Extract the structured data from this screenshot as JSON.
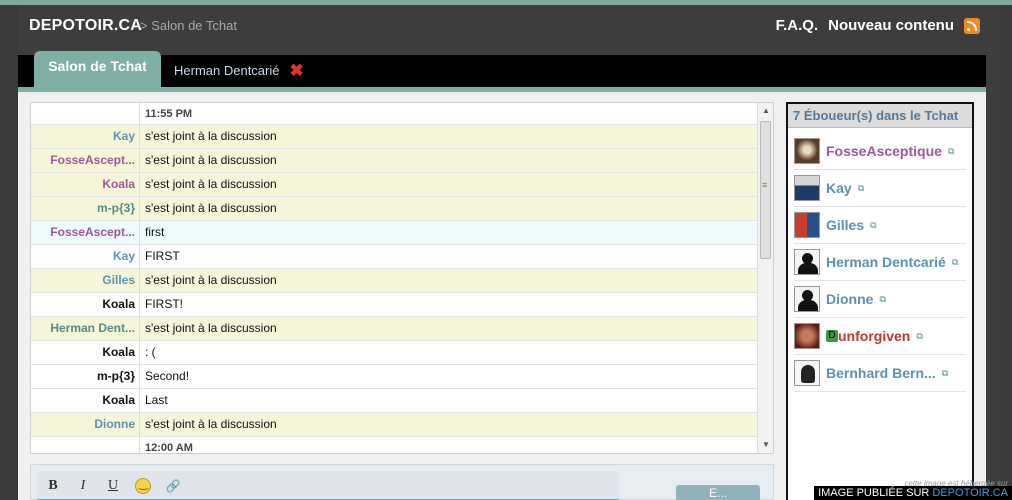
{
  "header": {
    "logo": "DEPOTOIR.CA",
    "breadcrumb": "> Salon de Tchat",
    "faq": "F.A.Q.",
    "new_content": "Nouveau contenu"
  },
  "tabs": {
    "active": "Salon de Tchat",
    "private_user": "Herman Dentcarié",
    "close_glyph": "✖"
  },
  "chat": {
    "time_top": "11:55 PM",
    "time_bottom": "12:00 AM",
    "messages": [
      {
        "who": "Kay",
        "msg": "s'est joint à la discussion",
        "type": "join",
        "color": "#5b93b5"
      },
      {
        "who": "FosseAscept...",
        "msg": "s'est joint à la discussion",
        "type": "join",
        "color": "#a0579d"
      },
      {
        "who": "Koala",
        "msg": "s'est joint à la discussion",
        "type": "join",
        "color": "#a0579d"
      },
      {
        "who": "m-p{3}",
        "msg": "s'est joint à la discussion",
        "type": "join",
        "color": "#4f8e8a"
      },
      {
        "who": "FosseAscept...",
        "msg": "first",
        "type": "hl",
        "color": "#a0579d"
      },
      {
        "who": "Kay",
        "msg": "FIRST",
        "type": "normal",
        "color": "#5b93b5"
      },
      {
        "who": "Gilles",
        "msg": "s'est joint à la discussion",
        "type": "join",
        "color": "#5b93b5"
      },
      {
        "who": "Koala",
        "msg": "FIRST!",
        "type": "normal",
        "color": "#111111"
      },
      {
        "who": "Herman Dent...",
        "msg": "s'est joint à la discussion",
        "type": "join",
        "color": "#4f8e8a"
      },
      {
        "who": "Koala",
        "msg": ": (",
        "type": "normal",
        "color": "#111111"
      },
      {
        "who": "m-p{3}",
        "msg": "Second!",
        "type": "normal",
        "color": "#111111"
      },
      {
        "who": "Koala",
        "msg": "Last",
        "type": "normal",
        "color": "#111111"
      },
      {
        "who": "Dionne",
        "msg": "s'est joint à la discussion",
        "type": "join",
        "color": "#5b93b5"
      }
    ]
  },
  "editor": {
    "bold": "B",
    "italic": "I",
    "underline": "U",
    "link_glyph": "🔗",
    "send_label": "E..."
  },
  "users_panel": {
    "title": "7 Éboueur(s) dans le Tchat",
    "ext_glyph": "⧉",
    "users": [
      {
        "name": "FosseAsceptique",
        "color": "#a0579d",
        "avatar": "a1"
      },
      {
        "name": "Kay",
        "color": "#5b93b5",
        "avatar": "a2"
      },
      {
        "name": "Gilles",
        "color": "#5b93b5",
        "avatar": "a3"
      },
      {
        "name": "Herman Dentcarié",
        "color": "#5b93b5",
        "avatar": "a4"
      },
      {
        "name": "Dionne",
        "color": "#5b93b5",
        "avatar": "a5"
      },
      {
        "name": "unforgiven",
        "color": "#c0392b",
        "avatar": "a6",
        "badge": "D"
      },
      {
        "name": "Bernhard Bern...",
        "color": "#5b93b5",
        "avatar": "a7"
      }
    ]
  },
  "watermark": {
    "small": "cette image est hébergée sur",
    "prefix": "IMAGE PUBLIÉE SUR ",
    "site": "DEPOTOIR.CA"
  }
}
